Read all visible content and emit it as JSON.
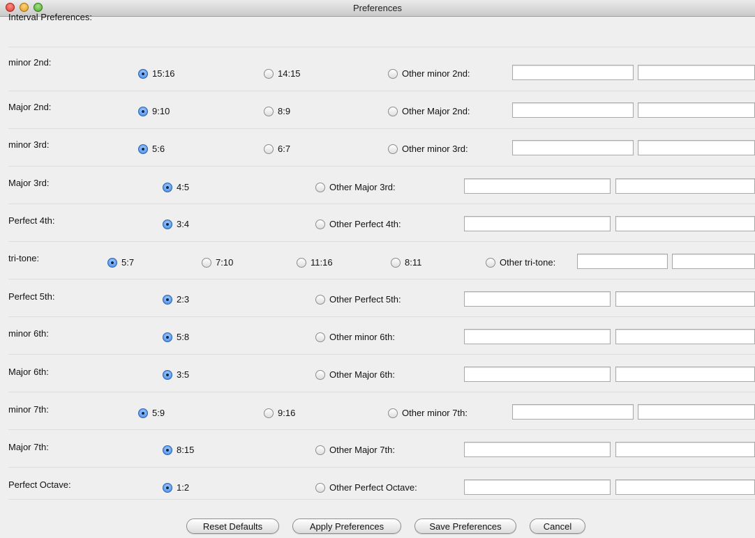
{
  "window": {
    "title": "Preferences"
  },
  "header": "Interval Preferences:",
  "rows": {
    "minor_2nd": {
      "label": "minor 2nd:",
      "options": [
        "15:16",
        "14:15"
      ],
      "other": "Other minor 2nd:",
      "selected": "15:16"
    },
    "major_2nd": {
      "label": "Major 2nd:",
      "options": [
        "9:10",
        "8:9"
      ],
      "other": "Other Major 2nd:",
      "selected": "9:10"
    },
    "minor_3rd": {
      "label": "minor 3rd:",
      "options": [
        "5:6",
        "6:7"
      ],
      "other": "Other minor 3rd:",
      "selected": "5:6"
    },
    "major_3rd": {
      "label": "Major 3rd:",
      "options": [
        "4:5"
      ],
      "other": "Other Major 3rd:",
      "selected": "4:5"
    },
    "perfect_4th": {
      "label": "Perfect 4th:",
      "options": [
        "3:4"
      ],
      "other": "Other Perfect 4th:",
      "selected": "3:4"
    },
    "tritone": {
      "label": "tri-tone:",
      "options": [
        "5:7",
        "7:10",
        "11:16",
        "8:11"
      ],
      "other": "Other tri-tone:",
      "selected": "5:7"
    },
    "perfect_5th": {
      "label": "Perfect 5th:",
      "options": [
        "2:3"
      ],
      "other": "Other Perfect 5th:",
      "selected": "2:3"
    },
    "minor_6th": {
      "label": "minor 6th:",
      "options": [
        "5:8"
      ],
      "other": "Other minor 6th:",
      "selected": "5:8"
    },
    "major_6th": {
      "label": "Major 6th:",
      "options": [
        "3:5"
      ],
      "other": "Other Major 6th:",
      "selected": "3:5"
    },
    "minor_7th": {
      "label": "minor 7th:",
      "options": [
        "5:9",
        "9:16"
      ],
      "other": "Other minor 7th:",
      "selected": "5:9"
    },
    "major_7th": {
      "label": "Major 7th:",
      "options": [
        "8:15"
      ],
      "other": "Other Major 7th:",
      "selected": "8:15"
    },
    "octave": {
      "label": "Perfect Octave:",
      "options": [
        "1:2"
      ],
      "other": "Other Perfect Octave:",
      "selected": "1:2"
    }
  },
  "buttons": {
    "reset": "Reset Defaults",
    "apply": "Apply Preferences",
    "save": "Save Preferences",
    "cancel": "Cancel"
  },
  "colors": {
    "selected_radio": "#3b82e0",
    "window_bg": "#efefef"
  }
}
